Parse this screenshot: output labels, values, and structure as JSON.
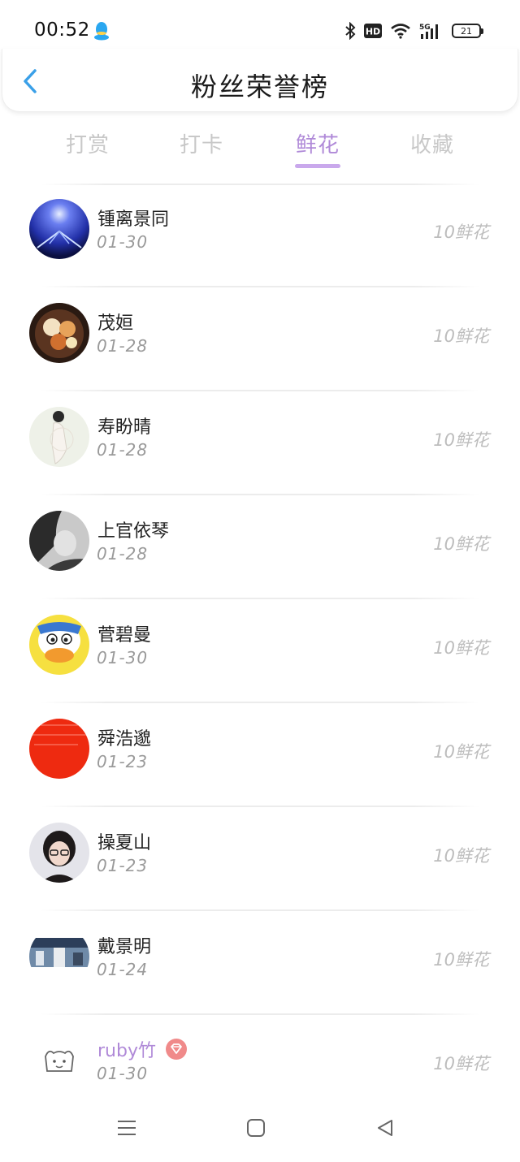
{
  "status_bar": {
    "time": "00:52",
    "battery": "21",
    "network": "5G",
    "hd": "HD"
  },
  "header": {
    "title": "粉丝荣誉榜",
    "back_icon": "chevron-left-icon"
  },
  "tabs": [
    {
      "label": "打赏",
      "active": false
    },
    {
      "label": "打卡",
      "active": false
    },
    {
      "label": "鲜花",
      "active": true
    },
    {
      "label": "收藏",
      "active": false
    }
  ],
  "colors": {
    "accent": "#b08ad8",
    "indicator": "#c9a8ec",
    "back": "#3aa0e8",
    "muted": "#bdbdbd"
  },
  "fans": [
    {
      "name": "锺离景同",
      "date": "01-30",
      "amount": "10鲜花",
      "avatar": "blue-light-avatar"
    },
    {
      "name": "茂姮",
      "date": "01-28",
      "amount": "10鲜花",
      "avatar": "food-bowl-avatar"
    },
    {
      "name": "寿盼晴",
      "date": "01-28",
      "amount": "10鲜花",
      "avatar": "pale-figure-avatar"
    },
    {
      "name": "上官依琴",
      "date": "01-28",
      "amount": "10鲜花",
      "avatar": "grayscale-portrait-avatar"
    },
    {
      "name": "菅碧曼",
      "date": "01-30",
      "amount": "10鲜花",
      "avatar": "cartoon-duck-avatar"
    },
    {
      "name": "舜浩邈",
      "date": "01-23",
      "amount": "10鲜花",
      "avatar": "red-text-avatar"
    },
    {
      "name": "操夏山",
      "date": "01-23",
      "amount": "10鲜花",
      "avatar": "glasses-woman-avatar"
    },
    {
      "name": "戴景明",
      "date": "01-24",
      "amount": "10鲜花",
      "avatar": "street-scene-avatar"
    },
    {
      "name": "ruby竹",
      "date": "01-30",
      "amount": "10鲜花",
      "avatar": "sketch-bear-avatar",
      "vip": true
    }
  ]
}
